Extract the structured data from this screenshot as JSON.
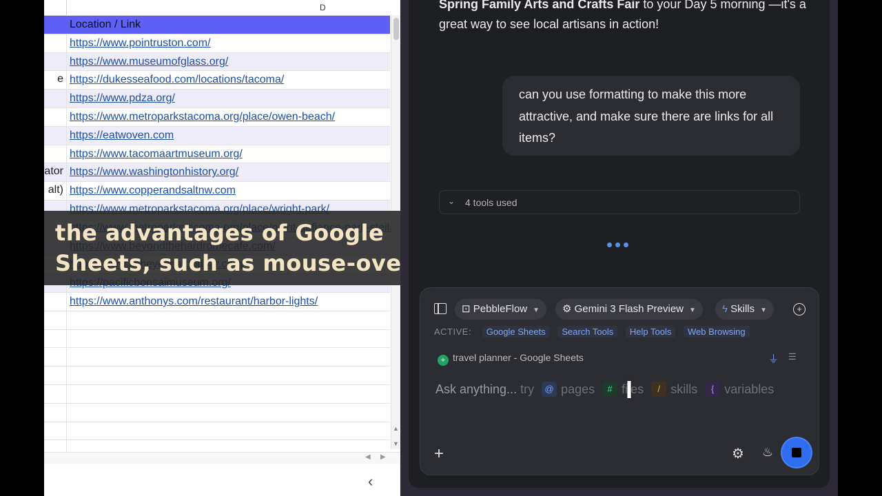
{
  "sheet": {
    "column_letter": "D",
    "header_label": "Location / Link",
    "rows": [
      {
        "a": "",
        "link": "https://www.pointruston.com/"
      },
      {
        "a": "",
        "link": "https://www.museumofglass.org/"
      },
      {
        "a": "e",
        "link": "https://dukesseafood.com/locations/tacoma/"
      },
      {
        "a": "",
        "link": "https://www.pdza.org/"
      },
      {
        "a": "",
        "link": "https://www.metroparkstacoma.org/place/owen-beach/"
      },
      {
        "a": "",
        "link": "https://eatwoven.com"
      },
      {
        "a": "",
        "link": "https://www.tacomaartmuseum.org/"
      },
      {
        "a": "ator",
        "link": "https://www.washingtonhistory.org/"
      },
      {
        "a": "alt)",
        "link": "https://www.copperandsaltnw.com"
      },
      {
        "a": "",
        "link": "https://www.metroparkstacoma.org/place/wright-park/"
      },
      {
        "a": "",
        "link": "https://www.metroparkstacoma.org/place/point-defiance-park-steilacoom"
      },
      {
        "a": "",
        "link": "https://www.beyondthehardromecafe.com/"
      },
      {
        "a": "",
        "link": "https://www.fisheyeseafoodbar.com/"
      },
      {
        "a": "",
        "link": "https://pacificbonsaimuseum.org/"
      },
      {
        "a": "",
        "link": "https://www.anthonys.com/restaurant/harbor-lights/"
      }
    ]
  },
  "caption": {
    "line1": "the advantages of Google",
    "line2": "Sheets, such as mouse-over"
  },
  "chat": {
    "prev_bold": "Spring Family Arts and Crafts Fair",
    "prev_rest": " to your Day 5 morning —it's a great way to see local artisans in action!",
    "user_message": "can you use formatting to make this more attractive, and make sure there are links for all items?",
    "tools_used": "4 tools used"
  },
  "composer": {
    "agent": "PebbleFlow",
    "model": "Gemini 3 Flash Preview",
    "skills": "Skills",
    "active_label": "ACTIVE:",
    "active_tools": [
      "Google Sheets",
      "Search Tools",
      "Help Tools",
      "Web Browsing"
    ],
    "context": "travel planner - Google Sheets",
    "prompt_start": "Ask anything...",
    "try": "try",
    "pages": "pages",
    "files": "files",
    "skills_word": "skills",
    "variables": "variables"
  },
  "colors": {
    "header_row": "#5d5ff5",
    "link": "#1a4fa8",
    "accent": "#2f6df0",
    "caption_text": "#f4e6c4"
  }
}
